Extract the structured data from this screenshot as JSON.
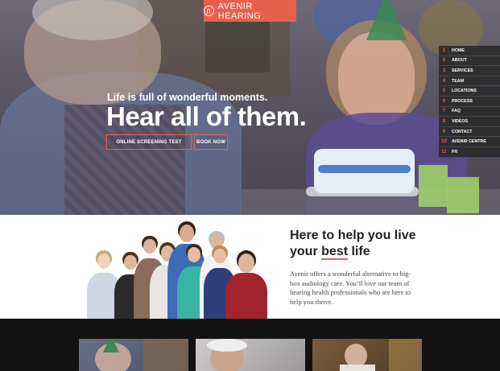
{
  "brand": {
    "name": "AVENIR HEARING",
    "accent": "#e8604c"
  },
  "hero": {
    "tagline": "Life is full of wonderful moments.",
    "headline": "Hear all of them.",
    "buttons": {
      "screening": "ONLINE SCREENING TEST",
      "book": "BOOK NOW"
    }
  },
  "nav": {
    "items": [
      {
        "num": "1",
        "label": "HOME"
      },
      {
        "num": "2",
        "label": "ABOUT"
      },
      {
        "num": "3",
        "label": "SERVICES"
      },
      {
        "num": "4",
        "label": "TEAM"
      },
      {
        "num": "5",
        "label": "LOCATIONS"
      },
      {
        "num": "6",
        "label": "PROCESS"
      },
      {
        "num": "7",
        "label": "FAQ"
      },
      {
        "num": "8",
        "label": "VIDEOS"
      },
      {
        "num": "9",
        "label": "CONTACT"
      },
      {
        "num": "10",
        "label": "AVENIR CENTRE"
      },
      {
        "num": "11",
        "label": "FR"
      }
    ]
  },
  "about": {
    "title_line1": "Here to help you live",
    "title_line2_pre": "your ",
    "title_line2_bold": "best",
    "title_line2_post": " life",
    "body": "Avenir offers a wonderful alternative to big-box audiology care. You’ll love our team of hearing health professionals who are here to help you thrive."
  }
}
